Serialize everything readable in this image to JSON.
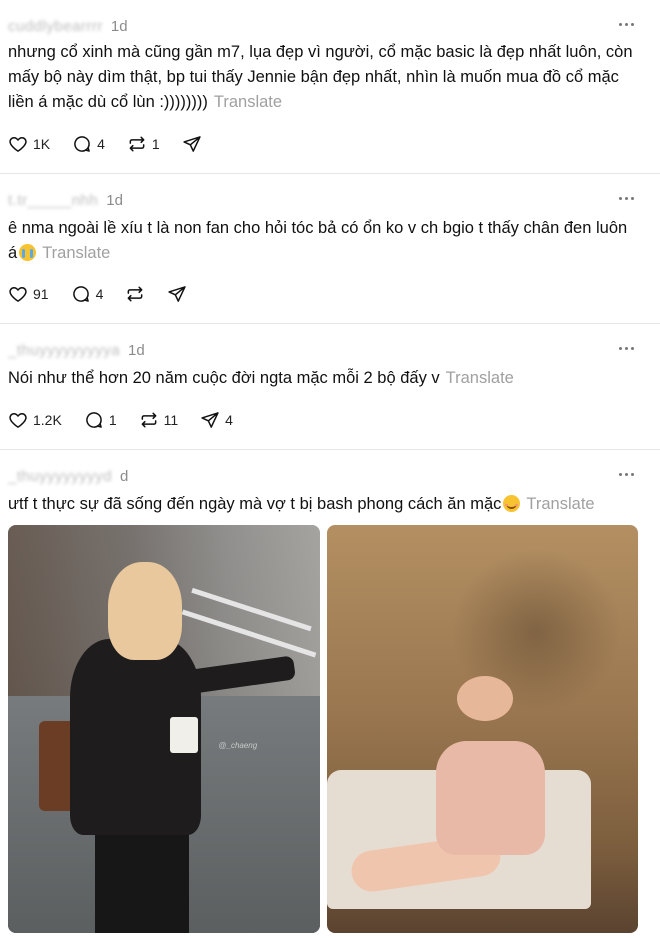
{
  "posts": [
    {
      "username": "cuddlybearrrr",
      "time": "1d",
      "text": "nhưng cổ xinh mà cũng gần m7, lụa đẹp vì người, cổ mặc basic là đẹp nhất luôn, còn mấy bộ này dìm thật, bp tui thấy Jennie bận đẹp nhất, nhìn là muốn mua đồ cổ mặc liền á mặc dù cổ lùn :))))))))",
      "translate": "Translate",
      "likes": "1K",
      "replies": "4",
      "reposts": "1",
      "shares": ""
    },
    {
      "username": "t.tr_____nhh",
      "time": "1d",
      "text": "ê nma ngoài lề xíu t là non fan cho hỏi tóc bả có ổn ko v ch bgio t thấy chân đen luôn á",
      "translate": "Translate",
      "likes": "91",
      "replies": "4",
      "reposts": "",
      "shares": ""
    },
    {
      "username": "_thuyyyyyyyyya",
      "time": "1d",
      "text": "Nói như thể hơn 20 năm cuộc đời ngta mặc mỗi 2 bộ đấy v",
      "translate": "Translate",
      "likes": "1.2K",
      "replies": "1",
      "reposts": "11",
      "shares": "4"
    },
    {
      "username": "_thuyyyyyyyyd",
      "time": "d",
      "text": "ưtf t thực sự đã sống đến ngày mà vợ t bị bash phong cách ăn mặc",
      "translate": "Translate",
      "image_watermark": "@_chaeng"
    }
  ],
  "icons": {
    "like": "heart-icon",
    "reply": "comment-icon",
    "repost": "repost-icon",
    "share": "send-icon",
    "more": "more-options-icon"
  }
}
